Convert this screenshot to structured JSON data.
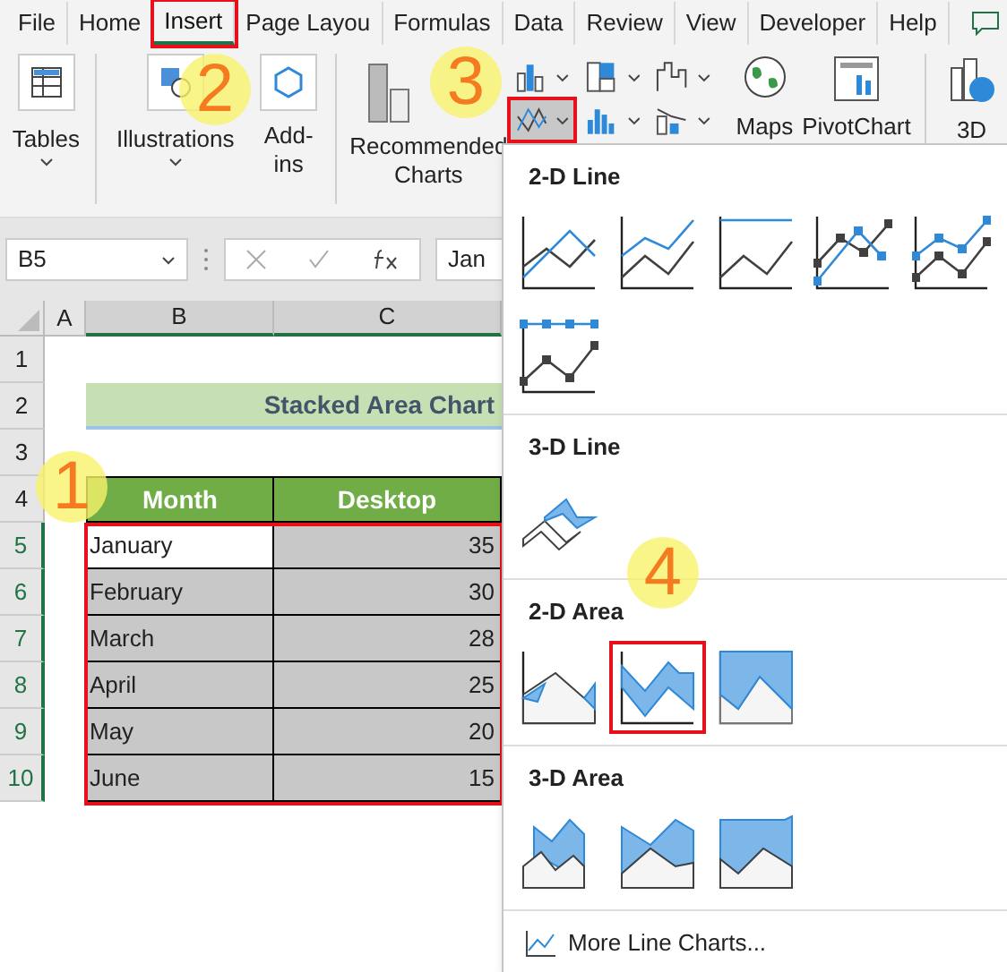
{
  "tabs": [
    {
      "label": "File",
      "selected": false
    },
    {
      "label": "Home",
      "selected": false
    },
    {
      "label": "Insert",
      "selected": true
    },
    {
      "label": "Page Layou",
      "selected": false
    },
    {
      "label": "Formulas",
      "selected": false
    },
    {
      "label": "Data",
      "selected": false
    },
    {
      "label": "Review",
      "selected": false
    },
    {
      "label": "View",
      "selected": false
    },
    {
      "label": "Developer",
      "selected": false
    },
    {
      "label": "Help",
      "selected": false
    }
  ],
  "ribbon": {
    "tables": "Tables",
    "illustrations": "Illustrations",
    "addins": "Add-\nins",
    "recommended": "Recommended\nCharts",
    "maps": "Maps",
    "pivotchart": "PivotChart",
    "map3d": "3D",
    "line_chart_selected": true
  },
  "formula_bar": {
    "name_box": "B5",
    "value": "Jan"
  },
  "columns": [
    "A",
    "B",
    "C"
  ],
  "rows": [
    "1",
    "2",
    "3",
    "4",
    "5",
    "6",
    "7",
    "8",
    "9",
    "10"
  ],
  "sheet": {
    "title": "Stacked Area Chart",
    "headers": [
      "Month",
      "Desktop"
    ],
    "data": [
      {
        "month": "January",
        "desktop": "35",
        "active": true
      },
      {
        "month": "February",
        "desktop": "30",
        "active": false
      },
      {
        "month": "March",
        "desktop": "28",
        "active": false
      },
      {
        "month": "April",
        "desktop": "25",
        "active": false
      },
      {
        "month": "May",
        "desktop": "20",
        "active": false
      },
      {
        "month": "June",
        "desktop": "15",
        "active": false
      }
    ]
  },
  "menu": {
    "sections": [
      {
        "title": "2-D Line",
        "items": [
          {
            "kind": "line",
            "selected": false
          },
          {
            "kind": "stacked-line",
            "selected": false
          },
          {
            "kind": "line-100",
            "selected": false
          },
          {
            "kind": "line-markers",
            "selected": false
          },
          {
            "kind": "stacked-line-markers",
            "selected": false
          },
          {
            "kind": "line-100-markers",
            "selected": false
          }
        ]
      },
      {
        "title": "3-D Line",
        "items": [
          {
            "kind": "line-3d",
            "selected": false
          }
        ]
      },
      {
        "title": "2-D Area",
        "items": [
          {
            "kind": "area",
            "selected": false
          },
          {
            "kind": "stacked-area",
            "selected": true
          },
          {
            "kind": "area-100",
            "selected": false
          }
        ]
      },
      {
        "title": "3-D Area",
        "items": [
          {
            "kind": "area-3d",
            "selected": false
          },
          {
            "kind": "stacked-area-3d",
            "selected": false
          },
          {
            "kind": "area-100-3d",
            "selected": false
          }
        ]
      }
    ],
    "more": "More Line Charts..."
  },
  "annotations": [
    "1",
    "2",
    "3",
    "4"
  ]
}
